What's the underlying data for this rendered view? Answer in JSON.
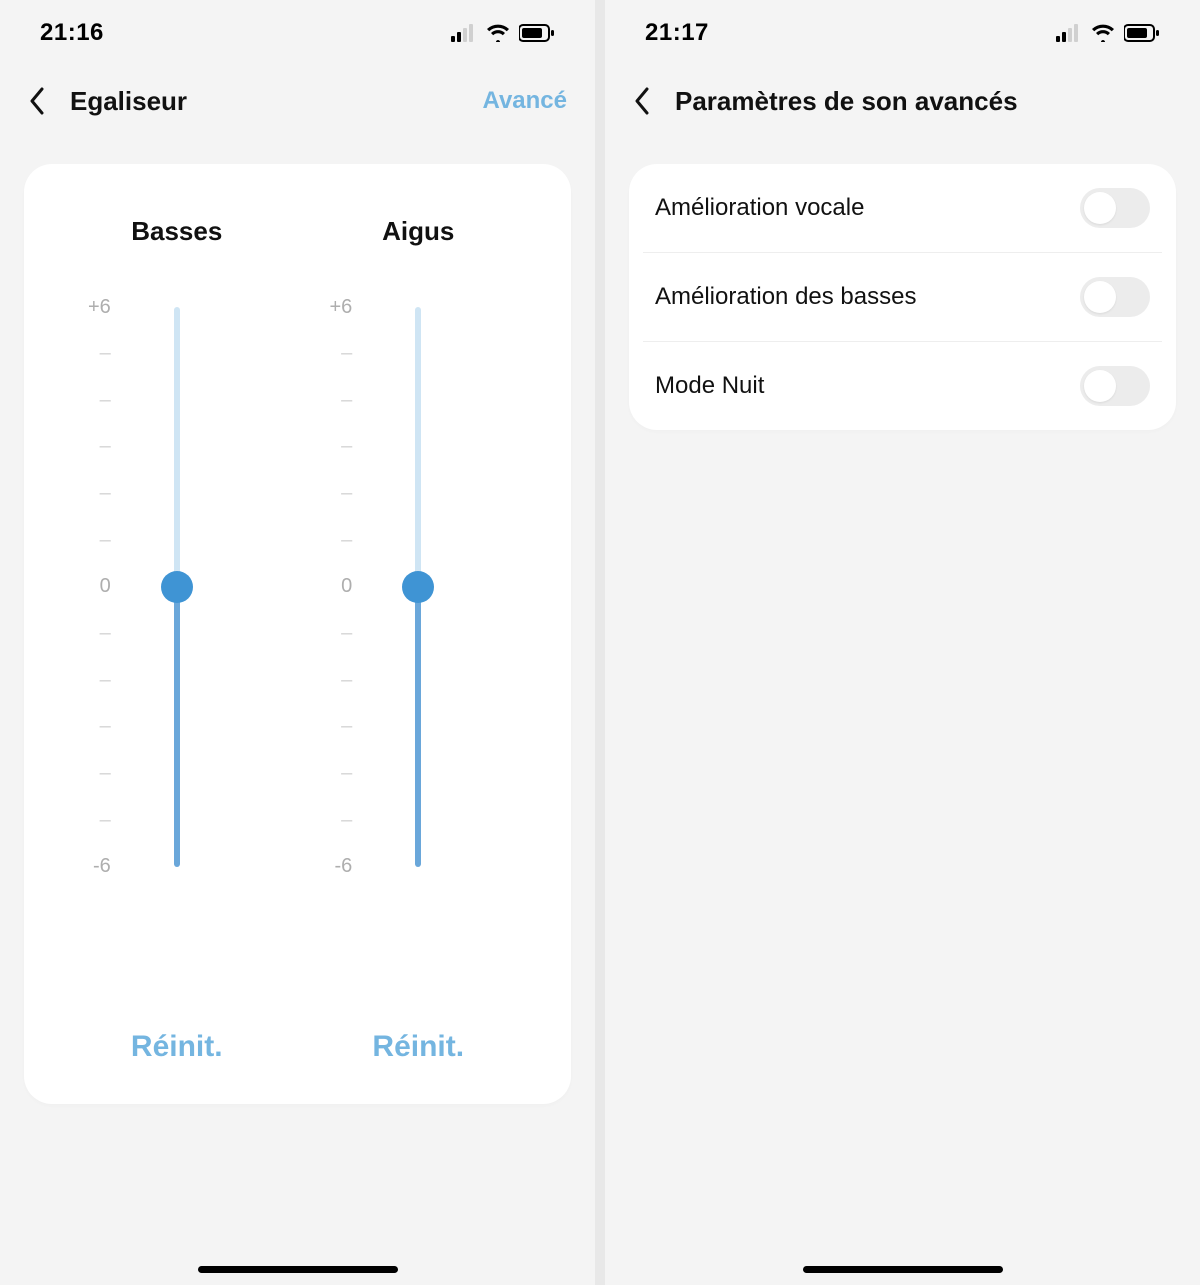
{
  "left": {
    "statusbar": {
      "time": "21:16"
    },
    "nav": {
      "title": "Egaliseur",
      "action": "Avancé"
    },
    "eq": {
      "columns": [
        {
          "label": "Basses",
          "max": "+6",
          "mid": "0",
          "min": "-6",
          "value": 0,
          "reset": "Réinit."
        },
        {
          "label": "Aigus",
          "max": "+6",
          "mid": "0",
          "min": "-6",
          "value": 0,
          "reset": "Réinit."
        }
      ]
    }
  },
  "right": {
    "statusbar": {
      "time": "21:17"
    },
    "nav": {
      "title": "Paramètres de son avancés"
    },
    "settings": {
      "rows": [
        {
          "label": "Amélioration vocale",
          "on": false
        },
        {
          "label": "Amélioration des basses",
          "on": false
        },
        {
          "label": "Mode Nuit",
          "on": false
        }
      ]
    }
  }
}
